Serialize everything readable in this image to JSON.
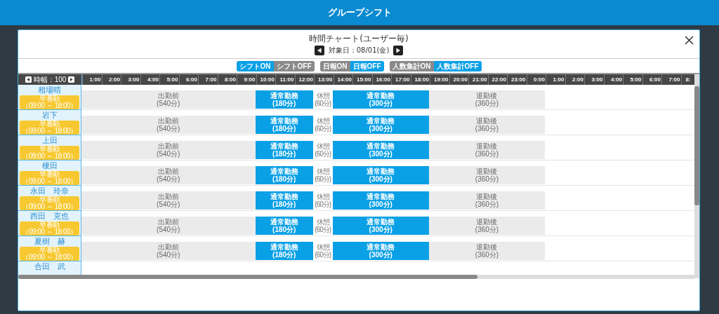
{
  "app_bar": {
    "title": "グループシフト"
  },
  "dialog": {
    "title": "時間チャート(ユーザー毎)",
    "date_label": "対象日：08/01(金)"
  },
  "toggles": [
    {
      "options": [
        {
          "label": "シフトON",
          "selected": true
        },
        {
          "label": "シフトOFF",
          "selected": false
        }
      ]
    },
    {
      "options": [
        {
          "label": "日報ON",
          "selected": false
        },
        {
          "label": "日報OFF",
          "selected": true
        }
      ]
    },
    {
      "options": [
        {
          "label": "人数集計ON",
          "selected": false
        },
        {
          "label": "人数集計OFF",
          "selected": true
        }
      ]
    }
  ],
  "chart": {
    "scale_label": "時幅：100",
    "hours": [
      "1:00",
      "2:00",
      "3:00",
      "4:00",
      "5:00",
      "6:00",
      "7:00",
      "8:00",
      "9:00",
      "10:00",
      "11:00",
      "12:00",
      "13:00",
      "14:00",
      "15:00",
      "16:00",
      "17:00",
      "18:00",
      "19:00",
      "20:00",
      "21:00",
      "22:00",
      "23:00",
      "0:00",
      "1:00",
      "2:00",
      "3:00",
      "4:00",
      "5:00",
      "6:00",
      "7:00",
      "8:"
    ],
    "rows": [
      {
        "name": "相場晴",
        "shift": {
          "name": "早番勤",
          "time": "（09:00 ～ 18:00）"
        },
        "segments": [
          {
            "kind": "pre",
            "label": "出勤前",
            "minutes": "(540分)"
          },
          {
            "kind": "work",
            "label": "通常勤務",
            "minutes": "(180分)"
          },
          {
            "kind": "break",
            "label": "休憩",
            "minutes": "(60分)"
          },
          {
            "kind": "work",
            "label": "通常勤務",
            "minutes": "(300分)"
          },
          {
            "kind": "post",
            "label": "退勤後",
            "minutes": "(360分)"
          }
        ]
      },
      {
        "name": "岩下",
        "shift": {
          "name": "早番勤",
          "time": "（09:00 ～ 18:00）"
        },
        "segments": [
          {
            "kind": "pre",
            "label": "出勤前",
            "minutes": "(540分)"
          },
          {
            "kind": "work",
            "label": "通常勤務",
            "minutes": "(180分)"
          },
          {
            "kind": "break",
            "label": "休憩",
            "minutes": "(60分)"
          },
          {
            "kind": "work",
            "label": "通常勤務",
            "minutes": "(300分)"
          },
          {
            "kind": "post",
            "label": "退勤後",
            "minutes": "(360分)"
          }
        ]
      },
      {
        "name": "上田",
        "shift": {
          "name": "早番勤",
          "time": "（09:00 ～ 18:00）"
        },
        "segments": [
          {
            "kind": "pre",
            "label": "出勤前",
            "minutes": "(540分)"
          },
          {
            "kind": "work",
            "label": "通常勤務",
            "minutes": "(180分)"
          },
          {
            "kind": "break",
            "label": "休憩",
            "minutes": "(60分)"
          },
          {
            "kind": "work",
            "label": "通常勤務",
            "minutes": "(300分)"
          },
          {
            "kind": "post",
            "label": "退勤後",
            "minutes": "(360分)"
          }
        ]
      },
      {
        "name": "榎田",
        "shift": {
          "name": "早番勤",
          "time": "（09:00 ～ 18:00）"
        },
        "segments": [
          {
            "kind": "pre",
            "label": "出勤前",
            "minutes": "(540分)"
          },
          {
            "kind": "work",
            "label": "通常勤務",
            "minutes": "(180分)"
          },
          {
            "kind": "break",
            "label": "休憩",
            "minutes": "(60分)"
          },
          {
            "kind": "work",
            "label": "通常勤務",
            "minutes": "(300分)"
          },
          {
            "kind": "post",
            "label": "退勤後",
            "minutes": "(360分)"
          }
        ]
      },
      {
        "name": "永田　玲奈",
        "shift": {
          "name": "早番勤",
          "time": "（09:00 ～ 18:00）"
        },
        "segments": [
          {
            "kind": "pre",
            "label": "出勤前",
            "minutes": "(540分)"
          },
          {
            "kind": "work",
            "label": "通常勤務",
            "minutes": "(180分)"
          },
          {
            "kind": "break",
            "label": "休憩",
            "minutes": "(60分)"
          },
          {
            "kind": "work",
            "label": "通常勤務",
            "minutes": "(300分)"
          },
          {
            "kind": "post",
            "label": "退勤後",
            "minutes": "(360分)"
          }
        ]
      },
      {
        "name": "西田　克也",
        "shift": {
          "name": "早番勤",
          "time": "（09:00 ～ 18:00）"
        },
        "segments": [
          {
            "kind": "pre",
            "label": "出勤前",
            "minutes": "(540分)"
          },
          {
            "kind": "work",
            "label": "通常勤務",
            "minutes": "(180分)"
          },
          {
            "kind": "break",
            "label": "休憩",
            "minutes": "(60分)"
          },
          {
            "kind": "work",
            "label": "通常勤務",
            "minutes": "(300分)"
          },
          {
            "kind": "post",
            "label": "退勤後",
            "minutes": "(360分)"
          }
        ]
      },
      {
        "name": "夏樹　赫",
        "shift": {
          "name": "早番勤",
          "time": "（09:00 ～ 18:00）"
        },
        "segments": [
          {
            "kind": "pre",
            "label": "出勤前",
            "minutes": "(540分)"
          },
          {
            "kind": "work",
            "label": "通常勤務",
            "minutes": "(180分)"
          },
          {
            "kind": "break",
            "label": "休憩",
            "minutes": "(60分)"
          },
          {
            "kind": "work",
            "label": "通常勤務",
            "minutes": "(300分)"
          },
          {
            "kind": "post",
            "label": "退勤後",
            "minutes": "(360分)"
          }
        ]
      },
      {
        "name": "合田　武"
      }
    ]
  }
}
